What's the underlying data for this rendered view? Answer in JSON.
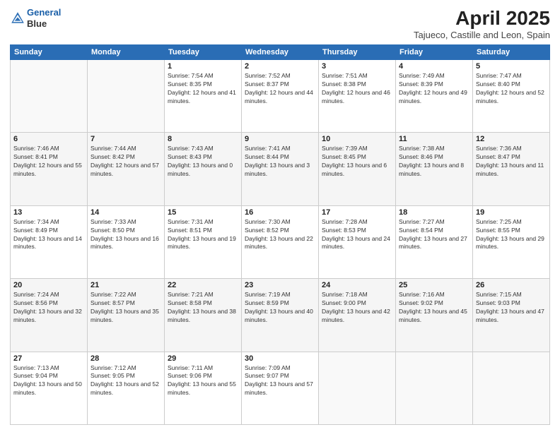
{
  "header": {
    "logo_line1": "General",
    "logo_line2": "Blue",
    "title": "April 2025",
    "subtitle": "Tajueco, Castille and Leon, Spain"
  },
  "days_of_week": [
    "Sunday",
    "Monday",
    "Tuesday",
    "Wednesday",
    "Thursday",
    "Friday",
    "Saturday"
  ],
  "weeks": [
    [
      {
        "day": "",
        "info": ""
      },
      {
        "day": "",
        "info": ""
      },
      {
        "day": "1",
        "info": "Sunrise: 7:54 AM\nSunset: 8:35 PM\nDaylight: 12 hours and 41 minutes."
      },
      {
        "day": "2",
        "info": "Sunrise: 7:52 AM\nSunset: 8:37 PM\nDaylight: 12 hours and 44 minutes."
      },
      {
        "day": "3",
        "info": "Sunrise: 7:51 AM\nSunset: 8:38 PM\nDaylight: 12 hours and 46 minutes."
      },
      {
        "day": "4",
        "info": "Sunrise: 7:49 AM\nSunset: 8:39 PM\nDaylight: 12 hours and 49 minutes."
      },
      {
        "day": "5",
        "info": "Sunrise: 7:47 AM\nSunset: 8:40 PM\nDaylight: 12 hours and 52 minutes."
      }
    ],
    [
      {
        "day": "6",
        "info": "Sunrise: 7:46 AM\nSunset: 8:41 PM\nDaylight: 12 hours and 55 minutes."
      },
      {
        "day": "7",
        "info": "Sunrise: 7:44 AM\nSunset: 8:42 PM\nDaylight: 12 hours and 57 minutes."
      },
      {
        "day": "8",
        "info": "Sunrise: 7:43 AM\nSunset: 8:43 PM\nDaylight: 13 hours and 0 minutes."
      },
      {
        "day": "9",
        "info": "Sunrise: 7:41 AM\nSunset: 8:44 PM\nDaylight: 13 hours and 3 minutes."
      },
      {
        "day": "10",
        "info": "Sunrise: 7:39 AM\nSunset: 8:45 PM\nDaylight: 13 hours and 6 minutes."
      },
      {
        "day": "11",
        "info": "Sunrise: 7:38 AM\nSunset: 8:46 PM\nDaylight: 13 hours and 8 minutes."
      },
      {
        "day": "12",
        "info": "Sunrise: 7:36 AM\nSunset: 8:47 PM\nDaylight: 13 hours and 11 minutes."
      }
    ],
    [
      {
        "day": "13",
        "info": "Sunrise: 7:34 AM\nSunset: 8:49 PM\nDaylight: 13 hours and 14 minutes."
      },
      {
        "day": "14",
        "info": "Sunrise: 7:33 AM\nSunset: 8:50 PM\nDaylight: 13 hours and 16 minutes."
      },
      {
        "day": "15",
        "info": "Sunrise: 7:31 AM\nSunset: 8:51 PM\nDaylight: 13 hours and 19 minutes."
      },
      {
        "day": "16",
        "info": "Sunrise: 7:30 AM\nSunset: 8:52 PM\nDaylight: 13 hours and 22 minutes."
      },
      {
        "day": "17",
        "info": "Sunrise: 7:28 AM\nSunset: 8:53 PM\nDaylight: 13 hours and 24 minutes."
      },
      {
        "day": "18",
        "info": "Sunrise: 7:27 AM\nSunset: 8:54 PM\nDaylight: 13 hours and 27 minutes."
      },
      {
        "day": "19",
        "info": "Sunrise: 7:25 AM\nSunset: 8:55 PM\nDaylight: 13 hours and 29 minutes."
      }
    ],
    [
      {
        "day": "20",
        "info": "Sunrise: 7:24 AM\nSunset: 8:56 PM\nDaylight: 13 hours and 32 minutes."
      },
      {
        "day": "21",
        "info": "Sunrise: 7:22 AM\nSunset: 8:57 PM\nDaylight: 13 hours and 35 minutes."
      },
      {
        "day": "22",
        "info": "Sunrise: 7:21 AM\nSunset: 8:58 PM\nDaylight: 13 hours and 38 minutes."
      },
      {
        "day": "23",
        "info": "Sunrise: 7:19 AM\nSunset: 8:59 PM\nDaylight: 13 hours and 40 minutes."
      },
      {
        "day": "24",
        "info": "Sunrise: 7:18 AM\nSunset: 9:00 PM\nDaylight: 13 hours and 42 minutes."
      },
      {
        "day": "25",
        "info": "Sunrise: 7:16 AM\nSunset: 9:02 PM\nDaylight: 13 hours and 45 minutes."
      },
      {
        "day": "26",
        "info": "Sunrise: 7:15 AM\nSunset: 9:03 PM\nDaylight: 13 hours and 47 minutes."
      }
    ],
    [
      {
        "day": "27",
        "info": "Sunrise: 7:13 AM\nSunset: 9:04 PM\nDaylight: 13 hours and 50 minutes."
      },
      {
        "day": "28",
        "info": "Sunrise: 7:12 AM\nSunset: 9:05 PM\nDaylight: 13 hours and 52 minutes."
      },
      {
        "day": "29",
        "info": "Sunrise: 7:11 AM\nSunset: 9:06 PM\nDaylight: 13 hours and 55 minutes."
      },
      {
        "day": "30",
        "info": "Sunrise: 7:09 AM\nSunset: 9:07 PM\nDaylight: 13 hours and 57 minutes."
      },
      {
        "day": "",
        "info": ""
      },
      {
        "day": "",
        "info": ""
      },
      {
        "day": "",
        "info": ""
      }
    ]
  ]
}
